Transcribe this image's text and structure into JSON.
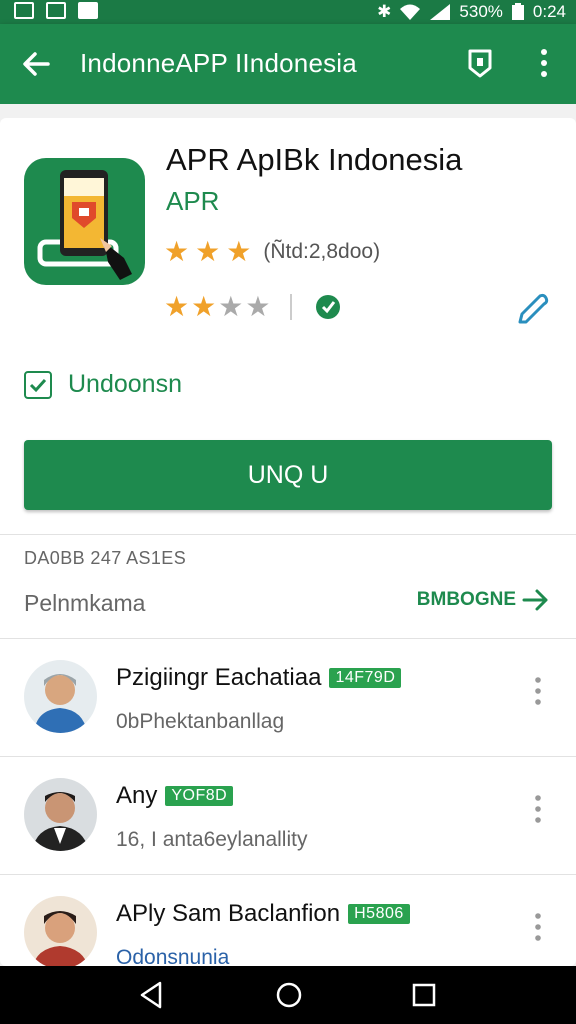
{
  "status_bar": {
    "battery": "530%",
    "time": "0:24"
  },
  "app_bar": {
    "title": "IndonneAPP IIndonesia",
    "back_icon": "arrow-back-icon",
    "action_icon": "shield-icon",
    "more_icon": "more-vert-icon"
  },
  "app": {
    "name": "APR ApIBk Indonesia",
    "developer": "APR",
    "rating_count": "(Ñtd:2,8doo)",
    "stars_rating": 2,
    "stars_max": 4,
    "check_label": "Undoonsn",
    "install_label": "UNQ U"
  },
  "reviews_section": {
    "label": "DA0BB 247 AS1ES",
    "title": "Pelnmkama",
    "see_more": "BMBOGNE"
  },
  "reviews": [
    {
      "name": "Pzigiingr Eachatiaa",
      "tag": "14F79D",
      "sub": "0bPhektanbanllag",
      "sub_style": "plain"
    },
    {
      "name": "Any",
      "tag": "YOF8D",
      "sub": "16, I anta6eylanallity",
      "sub_style": "plain"
    },
    {
      "name": "APly Sam Baclanfion",
      "tag": "H5806",
      "sub": "Odonsnunia",
      "sub_style": "link"
    }
  ],
  "colors": {
    "primary": "#1e8a4e",
    "status_bar": "#1b7a45",
    "star_on": "#f0a12a",
    "star_off": "#aaaaaa",
    "tag_green": "#2aa24f",
    "link_blue": "#2b62a8"
  }
}
